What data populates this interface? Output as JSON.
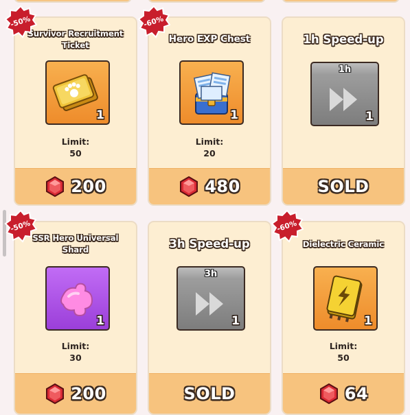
{
  "cards": [
    {
      "title": "Survivor Recruitment Ticket",
      "discount": "-50%",
      "item_icon": "ticket-icon",
      "quantity": "1",
      "limit_label": "Limit:",
      "limit_value": "50",
      "price": "200",
      "sold": false
    },
    {
      "title": "Hero EXP Chest",
      "discount": "-60%",
      "item_icon": "exp-chest-icon",
      "quantity": "1",
      "limit_label": "Limit:",
      "limit_value": "20",
      "price": "480",
      "sold": false
    },
    {
      "title": "1h Speed-up",
      "item_icon": "fast-forward-icon",
      "speed_tab": "1h",
      "quantity": "1",
      "price": "SOLD",
      "sold": true
    },
    {
      "title": "SSR Hero Universal Shard",
      "discount": "-50%",
      "item_icon": "puzzle-shard-icon",
      "quantity": "1",
      "limit_label": "Limit:",
      "limit_value": "30",
      "price": "200",
      "sold": false
    },
    {
      "title": "3h Speed-up",
      "item_icon": "fast-forward-icon",
      "speed_tab": "3h",
      "quantity": "1",
      "price": "SOLD",
      "sold": true
    },
    {
      "title": "Dielectric Ceramic",
      "discount": "-60%",
      "item_icon": "ceramic-chip-icon",
      "quantity": "1",
      "limit_label": "Limit:",
      "limit_value": "50",
      "price": "64",
      "sold": false
    }
  ],
  "colors": {
    "card_background": "#fdeed2",
    "price_bar": "#f7c37e",
    "discount_badge": "#c81e2c",
    "gem": "#d92a35"
  }
}
